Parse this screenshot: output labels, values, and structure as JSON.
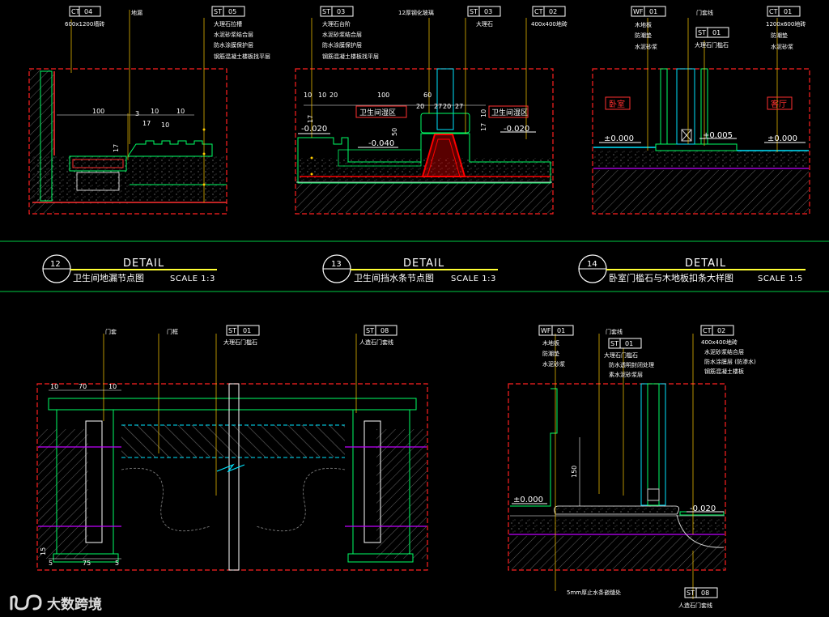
{
  "colors": {
    "background": "#000000",
    "frame": "#ff2020",
    "material": "#00ff66",
    "dimension": "#ffffff",
    "leader": "#ffcc00",
    "waterproof": "#ff0000",
    "finish": "#c000ff",
    "glass": "#00e5ff",
    "title_line": "#ffff33",
    "sheet_divider": "#00cc44"
  },
  "details": [
    {
      "id": "12",
      "heading": "DETAIL",
      "caption": "卫生间地漏节点图",
      "scale": "SCALE 1:3",
      "tags": [
        {
          "code": "CT",
          "num": "04",
          "notes": [
            "600x1200墙砖"
          ]
        },
        {
          "code": "",
          "num": "",
          "notes": [
            "地漏"
          ]
        },
        {
          "code": "ST",
          "num": "05",
          "notes": [
            "大理石拉槽",
            "水泥砂浆结合层",
            "防水涂膜保护层",
            "钢筋混凝土楼板找平层"
          ]
        }
      ],
      "dims": [
        "100",
        "3",
        "10",
        "10",
        "17",
        "10",
        "17"
      ]
    },
    {
      "id": "13",
      "heading": "DETAIL",
      "caption": "卫生间挡水条节点图",
      "scale": "SCALE 1:3",
      "tags": [
        {
          "code": "ST",
          "num": "03",
          "notes": [
            "大理石台阶",
            "水泥砂浆结合层",
            "防水涂膜保护层",
            "钢筋混凝土楼板找平层"
          ]
        },
        {
          "code": "",
          "num": "",
          "notes": [
            "12厚钢化玻璃"
          ]
        },
        {
          "code": "ST",
          "num": "03",
          "notes": [
            "大理石"
          ]
        },
        {
          "code": "CT",
          "num": "02",
          "notes": [
            "400x400地砖"
          ]
        }
      ],
      "dims": [
        "10",
        "10",
        "20",
        "100",
        "60",
        "20",
        "27",
        "20",
        "27",
        "17",
        "50",
        "17",
        "10"
      ],
      "rooms": [
        "卫生间湿区",
        "卫生间湿区"
      ],
      "elevations": [
        "-0.020",
        "-0.040",
        "-0.020"
      ]
    },
    {
      "id": "14",
      "heading": "DETAIL",
      "caption": "卧室门槛石与木地板扣条大样图",
      "scale": "SCALE 1:5",
      "tags": [
        {
          "code": "WF",
          "num": "01",
          "notes": [
            "木地板",
            "防潮垫",
            "水泥砂浆"
          ]
        },
        {
          "code": "",
          "num": "",
          "notes": [
            "门套线"
          ]
        },
        {
          "code": "ST",
          "num": "01",
          "notes": [
            "大理石门槛石"
          ]
        },
        {
          "code": "CT",
          "num": "01",
          "notes": [
            "1200x600地砖",
            "防潮垫",
            "水泥砂浆"
          ]
        }
      ],
      "rooms": [
        "卧室",
        "客厅"
      ],
      "elevations": [
        "±0.000",
        "+0.005",
        "±0.000"
      ]
    },
    {
      "id": "15",
      "tags": [
        {
          "code": "",
          "num": "",
          "notes": [
            "门套"
          ]
        },
        {
          "code": "",
          "num": "",
          "notes": [
            "门框"
          ]
        },
        {
          "code": "ST",
          "num": "01",
          "notes": [
            "大理石门槛石"
          ]
        },
        {
          "code": "ST",
          "num": "08",
          "notes": [
            "人造石门套线"
          ]
        }
      ],
      "dims": [
        "10",
        "70",
        "10",
        "75",
        "5",
        "5",
        "15"
      ]
    },
    {
      "id": "16",
      "tags": [
        {
          "code": "WF",
          "num": "01",
          "notes": [
            "木地板",
            "防潮垫",
            "水泥砂浆"
          ]
        },
        {
          "code": "",
          "num": "",
          "notes": [
            "门套线"
          ]
        },
        {
          "code": "ST",
          "num": "01",
          "notes": [
            "大理石门槛石",
            "防水透明封闭处理",
            "素水泥砂浆层"
          ]
        },
        {
          "code": "CT",
          "num": "02",
          "notes": [
            "400x400地砖",
            "水泥砂浆结合层",
            "防水涂膜层 (防渗水)",
            "钢筋混凝土楼板"
          ]
        },
        {
          "code": "ST",
          "num": "08",
          "notes": [
            "人造石门套线"
          ]
        }
      ],
      "dims": [
        "150"
      ],
      "elevations": [
        "±0.000",
        "-0.020"
      ],
      "bottom_note": "5mm厚止水条嵌缝处"
    }
  ],
  "watermark": "大数跨境"
}
